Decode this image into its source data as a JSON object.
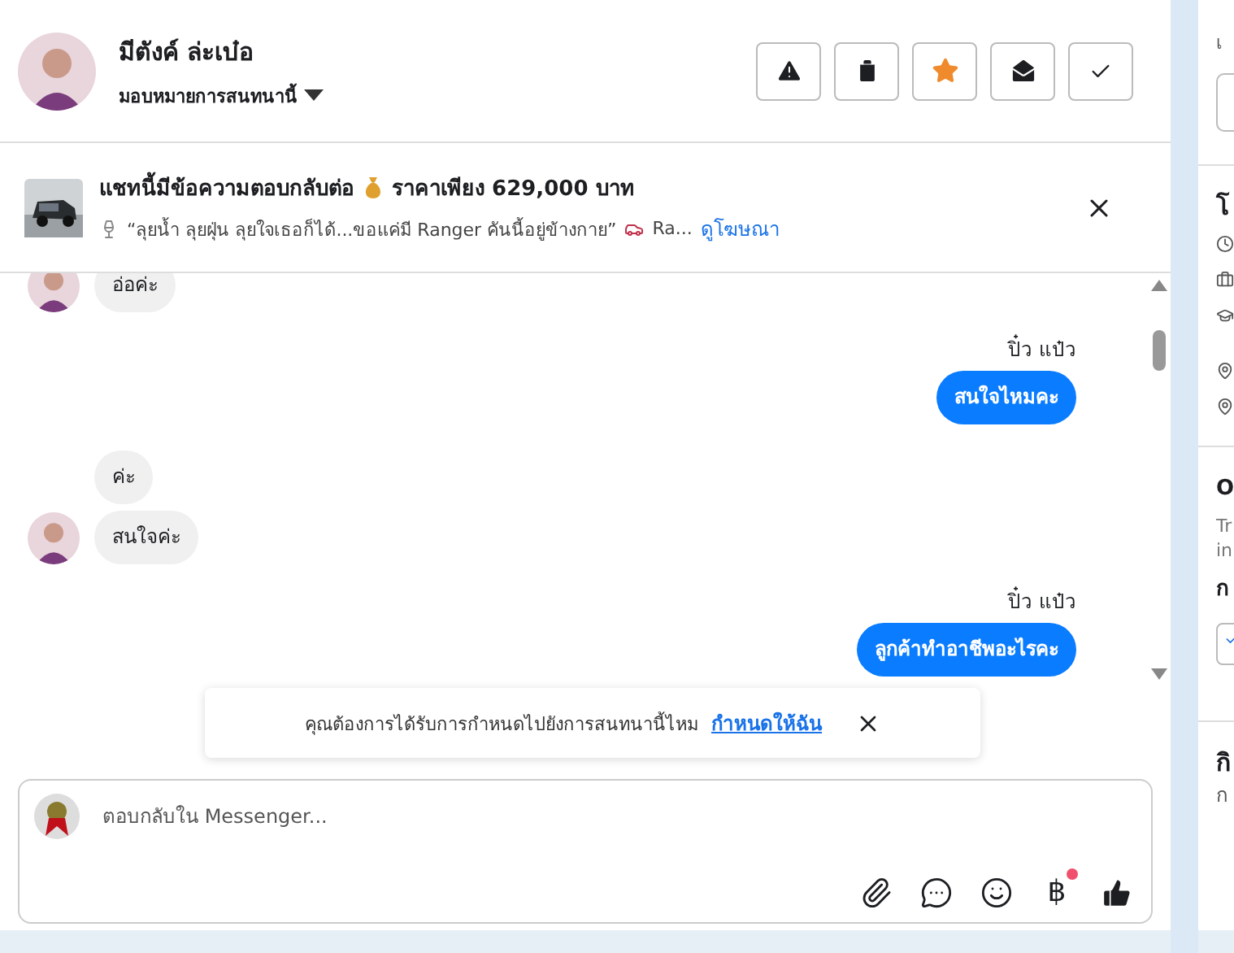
{
  "header": {
    "name": "มีตังค์ ล่ะเบ๋อ",
    "assign_label": "มอบหมายการสนทนานี้",
    "actions": [
      {
        "kind": "alert"
      },
      {
        "kind": "delete"
      },
      {
        "kind": "star"
      },
      {
        "kind": "unread"
      },
      {
        "kind": "done"
      }
    ]
  },
  "ad_banner": {
    "title": "แชทนี้มีข้อความตอบกลับต่อ",
    "price": "ราคาเพียง 629,000 บาท",
    "quote": "“ลุยน้ำ ลุยฝุ่น ลุยใจเธอก็ได้...ขอแค่มี Ranger คันนี้อยู่ข้างกาย”",
    "more": "Ra...",
    "link": "ดูโฆษณา"
  },
  "messages": [
    {
      "kind": "incoming",
      "text": "อ่อค่ะ",
      "avatar": true
    },
    {
      "kind": "sender",
      "text": "ปิ๋ว แป๋ว"
    },
    {
      "kind": "outgoing",
      "text": "สนใจไหมคะ"
    },
    {
      "kind": "incoming",
      "text": "ค่ะ",
      "avatar": false
    },
    {
      "kind": "incoming",
      "text": "สนใจค่ะ",
      "avatar": true
    },
    {
      "kind": "sender",
      "text": "ปิ๋ว แป๋ว"
    },
    {
      "kind": "outgoing",
      "text": "ลูกค้าทำอาชีพอะไรคะ"
    }
  ],
  "assign_notice": {
    "text": "คุณต้องการได้รับการกำหนดไปยังการสนทนานี้ไหม",
    "link": "กำหนดให้ฉัน"
  },
  "composer": {
    "placeholder": "ตอบกลับใน Messenger...",
    "tools": [
      {
        "kind": "attach",
        "badge": false
      },
      {
        "kind": "chat",
        "badge": false
      },
      {
        "kind": "emoji",
        "badge": false
      },
      {
        "kind": "currency",
        "label": "฿",
        "badge": true
      },
      {
        "kind": "like",
        "badge": false
      }
    ]
  },
  "side_panel": {
    "top_label": "เ",
    "heading": "โ",
    "details": [
      {
        "kind": "clock"
      },
      {
        "kind": "briefcase"
      },
      {
        "kind": "school"
      },
      {
        "kind": "pin"
      },
      {
        "kind": "pin"
      }
    ],
    "section_title": "O",
    "section_note": [
      "Tr",
      "in"
    ],
    "option_label": "ก",
    "option_checked": true,
    "activity_title": "กิ",
    "activity_note": "ก"
  }
}
